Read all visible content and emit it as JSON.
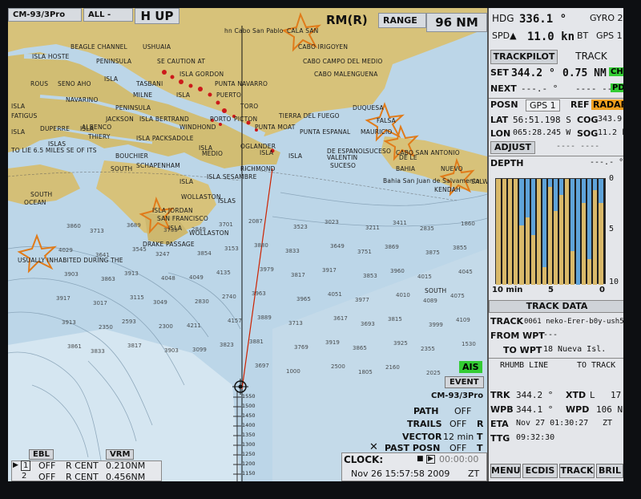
{
  "top": {
    "product": "CM-93/3Pro",
    "scale": "ALL -",
    "orientation": "H UP",
    "mode": "RM(R)",
    "range_label": "RANGE",
    "range_value": "96 NM"
  },
  "chart_labels": [
    "BEAGLE CHANNEL",
    "USHUAIA",
    "ISLA HOSTE",
    "PENINSULA",
    "SE CAUTION AT",
    "ISLA GORDON",
    "ROUS",
    "SENO AHO",
    "ISLA",
    "TASBANI",
    "PUNTA NAVARRO",
    "PUERTO",
    "MILNE",
    "ISLA",
    "TORO",
    "ISLA",
    "NAVARINO",
    "PENINSULA",
    "TIERRA DEL FUEGO",
    "DUQUESA",
    "FATIGUS",
    "JACKSON",
    "ISLA BERTRAND",
    "PORTO",
    "PICTON",
    "PUNTA MOAT",
    "DUPERRE",
    "ALBENCO",
    "WINDHOND",
    "ISLA",
    "PUNTA ESPANAL",
    "MAURICIO",
    "FALSA",
    "ISLA",
    "THIERY",
    "ISLA PACKSADOLE",
    "DE ESPANOL",
    "ISLA",
    "CABO SAN ANTONIO",
    "ISLAS",
    "TO LIE 6.5 MILES SE OF ITS",
    "BOUCHIER",
    "MEDIO",
    "OGLANDER",
    "SUCESO",
    "DE LE",
    "ISLA",
    "SOUTH",
    "SCHAPENHAM",
    "RICHMOND",
    "VALENTIN",
    "BAHIA",
    "NUEVO",
    "SALW",
    "ISLA",
    "ISLA SESAMBRE",
    "SUCESO",
    "Bahia San Juan de Salvamento",
    "KENDAH",
    "SOUTH",
    "ISLA",
    "WOLLASTON",
    "ISLAS",
    "OCEAN",
    "ISLA JORDAN",
    "SAN FRANCISCO",
    "ISLA",
    "WOLLASTON",
    "DRAKE PASSAGE",
    "USUALLY INHABITED DURING THE",
    "SOUTH",
    "hn Cabo San Pablo",
    "CALA SAN",
    "CABO IRIGOYEN",
    "CABO CAMPO DEL MEDIO",
    "CABO MALENGUENA"
  ],
  "depths": [
    "2087",
    "3523",
    "3023",
    "3211",
    "3411",
    "2835",
    "1860",
    "2849",
    "3701",
    "3733",
    "3689",
    "3713",
    "3860",
    "3880",
    "3833",
    "3649",
    "3751",
    "3869",
    "3875",
    "3855",
    "3854",
    "3153",
    "3247",
    "3545",
    "3641",
    "4029",
    "3979",
    "3817",
    "3917",
    "3853",
    "3960",
    "4015",
    "4045",
    "4049",
    "4135",
    "4048",
    "3913",
    "3863",
    "3903",
    "3963",
    "3965",
    "4051",
    "3977",
    "4010",
    "4089",
    "4075",
    "2830",
    "2740",
    "3049",
    "3115",
    "3017",
    "3917",
    "3889",
    "3713",
    "3617",
    "3693",
    "3815",
    "3999",
    "4109",
    "4211",
    "4157",
    "2300",
    "2593",
    "2350",
    "3913",
    "3881",
    "3769",
    "3919",
    "3865",
    "3925",
    "2355",
    "1530",
    "3099",
    "3823",
    "3903",
    "3817",
    "3833",
    "3861",
    "3697",
    "1000",
    "2500",
    "1805",
    "2160",
    "2025"
  ],
  "ownship_scale": [
    "1550",
    "1500",
    "1450",
    "1400",
    "1350",
    "1300",
    "1250",
    "1200",
    "1150"
  ],
  "right_panel": {
    "hdg_label": "HDG",
    "hdg_value": "336.1 °",
    "gyro": "GYRO 2",
    "spd_label": "SPD▲",
    "spd_value": "11.0 kn",
    "spd_src": "BT",
    "gps": "GPS 1",
    "trackpilot": "TRACKPILOT",
    "track": "TRACK",
    "set_label": "SET",
    "set_value": "344.2 °",
    "set_dist": "0.75 NM",
    "chl": "CHL",
    "next_label": "NEXT",
    "next_value": "---.- °",
    "next_dist": "---- --",
    "pd": "PD",
    "posn_label": "POSN",
    "posn_src": "GPS 1",
    "ref_label": "REF",
    "radar": "RADAR",
    "lat_label": "LAT",
    "lat_value": "56:51.198 S",
    "cog_label": "COG",
    "cog_value": "343.9 °",
    "lon_label": "LON",
    "lon_value": "065:28.245 W",
    "sog_label": "SOG",
    "sog_value": "11.2 kn",
    "adjust": "ADJUST",
    "adjust_values": "---- ----",
    "depth_label": "DEPTH",
    "depth_value": "---.- °",
    "depth_axis": [
      "0",
      "5",
      "10"
    ],
    "depth_time": [
      "10 min",
      "5",
      "0"
    ],
    "track_data_title": "TRACK DATA",
    "track_label": "TRACK",
    "track_value": "0061 neko-Erer-b0y-ush5",
    "from_wpt_label": "FROM WPT",
    "from_wpt_value": "----",
    "to_wpt_label": "TO WPT",
    "to_wpt_value": "18 Nueva Isl.",
    "rhumb": "RHUMB LINE",
    "to_track": "TO TRACK",
    "trk_label": "TRK",
    "trk_value": "344.2 °",
    "xtd_label": "XTD",
    "xtd_side": "L",
    "xtd_value": "17",
    "wpb_label": "WPB",
    "wpb_value": "344.1 °",
    "wpd_label": "WPD",
    "wpd_value": "106 N",
    "eta_label": "ETA",
    "eta_value": "Nov 27 01:30:27",
    "eta_zone": "ZT",
    "ttg_label": "TTG",
    "ttg_value": "09:32:30",
    "menu": "MENU",
    "ecdis": "ECDIS",
    "trackbtn": "TRACK",
    "bril": "BRIL"
  },
  "overlay": {
    "ais": "AIS",
    "event": "EVENT",
    "product2": "CM-93/3Pro",
    "path_label": "PATH",
    "path_value": "OFF",
    "trails_label": "TRAILS",
    "trails_value": "OFF",
    "trails_unit": "R",
    "vector_label": "VECTOR",
    "vector_value": "12 min",
    "vector_unit": "T",
    "pastposn_label": "PAST POSN",
    "pastposn_value": "OFF",
    "pastposn_unit": "T"
  },
  "bottom": {
    "ebl": "EBL",
    "vrm": "VRM",
    "row1_num": "1",
    "row1_ebl": "OFF",
    "row1_rcent": "R CENT",
    "row1_vrm": "0.210NM",
    "row2_num": "2",
    "row2_ebl": "OFF",
    "row2_rcent": "R CENT",
    "row2_vrm": "0.456NM",
    "clock_label": "CLOCK:",
    "clock_timer": "00:00:00",
    "clock_value": "Nov 26 15:57:58 2009",
    "clock_zone": "ZT"
  },
  "colors": {
    "land": "#d7c27a",
    "sea": "#bcd6e8",
    "panel": "#e4e6ea",
    "green": "#33cc33",
    "orange": "#f0a020",
    "track": "#cc2200"
  }
}
